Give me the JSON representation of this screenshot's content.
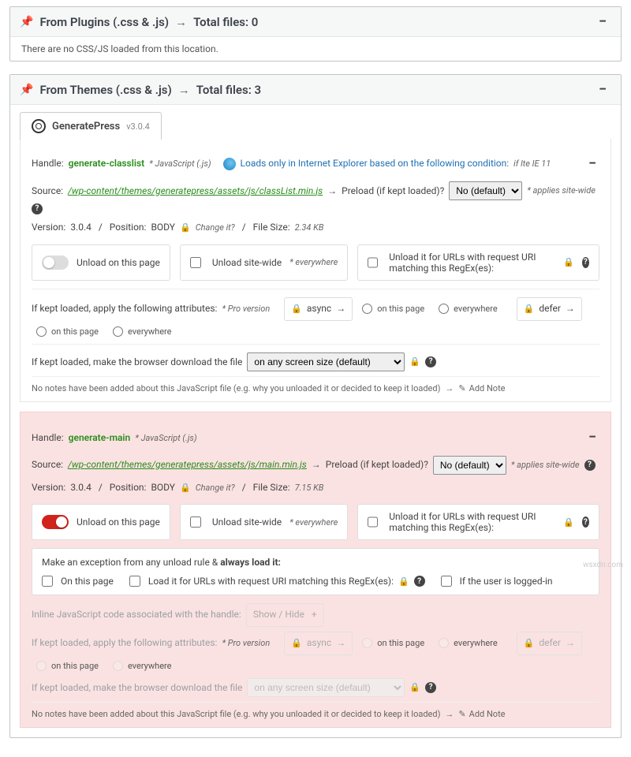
{
  "panels": {
    "plugins": {
      "title_prefix": "From Plugins (.css & .js)",
      "arrow": "→",
      "title_suffix": "Total files: 0",
      "note": "There are no CSS/JS loaded from this location."
    },
    "themes": {
      "title_prefix": "From Themes (.css & .js)",
      "arrow": "→",
      "title_suffix": "Total files: 3"
    }
  },
  "theme_tab": {
    "name": "GeneratePress",
    "version": "v3.0.4"
  },
  "common": {
    "handle_label": "Handle:",
    "source_label": "Source:",
    "arrow": "→",
    "preload_label": "Preload (if kept loaded)?",
    "preload_default": "No (default)",
    "applies_sitewide": "* applies site-wide",
    "version_label": "Version:",
    "position_label": "Position:",
    "position_body": "BODY",
    "change_it": "Change it?",
    "filesize_label": "File Size:",
    "unload_page": "Unload on this page",
    "unload_sitewide": "Unload site-wide",
    "everywhere_hint": "* everywhere",
    "unload_regex": "Unload it for URLs with request URI matching this RegEx(es):",
    "attrs_label": "If kept loaded, apply the following attributes:",
    "pro_hint": "* Pro version",
    "async": "async",
    "defer": "defer",
    "on_page": "on this page",
    "everywhere": "everywhere",
    "download_label": "If kept loaded, make the browser download the file",
    "screen_default": "on any screen size (default)",
    "note_text": "No notes have been added about this JavaScript file (e.g. why you unloaded it or decided to keep it loaded)",
    "add_note": "Add Note"
  },
  "asset1": {
    "handle": "generate-classlist",
    "type": "* JavaScript (.js)",
    "ie_text": "Loads only in Internet Explorer based on the following condition:",
    "ie_cond": "if lte IE 11",
    "src": "/wp-content/themes/generatepress/assets/js/classList.min.js",
    "version": "3.0.4",
    "filesize": "2.34 KB"
  },
  "asset2": {
    "handle": "generate-main",
    "type": "* JavaScript (.js)",
    "src": "/wp-content/themes/generatepress/assets/js/main.min.js",
    "version": "3.0.4",
    "filesize": "7.15 KB"
  },
  "exception": {
    "head_a": "Make an exception from any unload rule &",
    "head_b": "always load it:",
    "on_page": "On this page",
    "regex": "Load it for URLs with request URI matching this RegEx(es):",
    "logged_in": "If the user is logged-in"
  },
  "inline_js": {
    "label": "Inline JavaScript code associated with the handle:",
    "toggle": "Show / Hide"
  },
  "watermark": "wsxdn.com"
}
